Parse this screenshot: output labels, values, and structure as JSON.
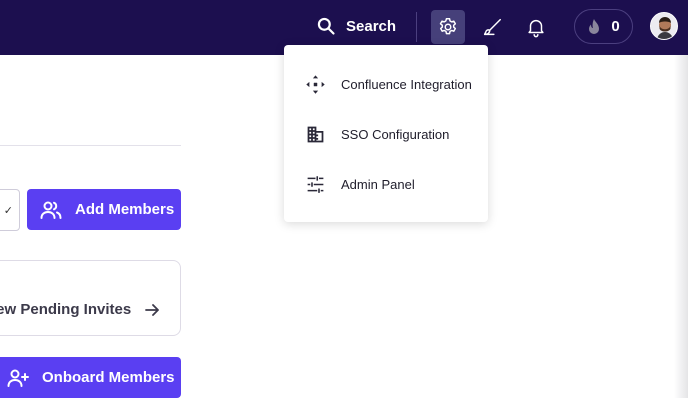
{
  "header": {
    "search_label": "Search",
    "points_count": "0",
    "icons": [
      "search-icon",
      "gear-icon",
      "brush-icon",
      "bell-icon",
      "flame-icon"
    ]
  },
  "menu": {
    "items": [
      {
        "label": "Confluence Integration",
        "icon": "move-arrows-icon"
      },
      {
        "label": "SSO Configuration",
        "icon": "building-icon"
      },
      {
        "label": "Admin Panel",
        "icon": "sliders-icon"
      }
    ]
  },
  "main": {
    "add_members_label": "Add Members",
    "pending_invites_label": "iew Pending Invites",
    "onboard_members_label": "Onboard Members",
    "select_chevron": "✓"
  },
  "colors": {
    "topbar": "#1c0f4f",
    "primary": "#5a3ff2",
    "gear_active_bg": "#46407a"
  }
}
